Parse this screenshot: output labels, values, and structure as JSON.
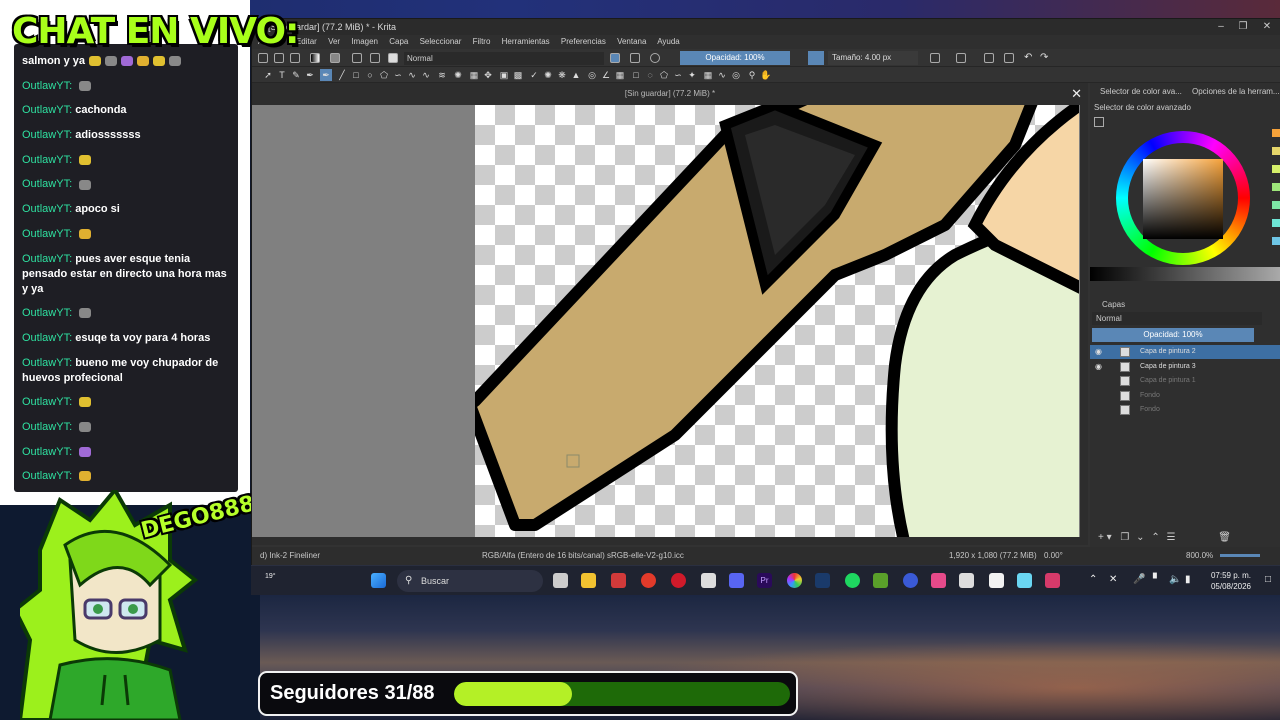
{
  "overlay": {
    "chat_title": "CHAT EN VIVO:",
    "avatar_tag": "DEGO888",
    "followers_label": "Seguidores 31/88",
    "followers_progress": 0.35
  },
  "chat": [
    {
      "user": "",
      "text": "salmon y ya",
      "emotes": 6
    },
    {
      "user": "OutlawYT:",
      "text": "",
      "emotes": 1
    },
    {
      "user": "OutlawYT:",
      "text": "cachonda",
      "emotes": 0
    },
    {
      "user": "OutlawYT:",
      "text": "adiosssssss",
      "emotes": 0
    },
    {
      "user": "OutlawYT:",
      "text": "",
      "emotes": 1
    },
    {
      "user": "OutlawYT:",
      "text": "",
      "emotes": 1
    },
    {
      "user": "OutlawYT:",
      "text": "apoco si",
      "emotes": 0
    },
    {
      "user": "OutlawYT:",
      "text": "",
      "emotes": 1
    },
    {
      "user": "OutlawYT:",
      "text": "pues aver esque tenia pensado estar en directo una hora mas y ya",
      "emotes": 0
    },
    {
      "user": "OutlawYT:",
      "text": "",
      "emotes": 1
    },
    {
      "user": "OutlawYT:",
      "text": "esuqe ta voy para 4 horas",
      "emotes": 0
    },
    {
      "user": "OutlawYT:",
      "text": "bueno me voy chupador de huevos profecional",
      "emotes": 0
    },
    {
      "user": "OutlawYT:",
      "text": "",
      "emotes": 1
    },
    {
      "user": "OutlawYT:",
      "text": "",
      "emotes": 1
    },
    {
      "user": "OutlawYT:",
      "text": "",
      "emotes": 1
    },
    {
      "user": "OutlawYT:",
      "text": "",
      "emotes": 1
    }
  ],
  "krita": {
    "window_title": "[Sin guardar]  (77.2 MiB) * - Krita",
    "doc_title": "[Sin guardar]  (77.2 MiB) *",
    "menu": [
      "Archivo",
      "Editar",
      "Ver",
      "Imagen",
      "Capa",
      "Seleccionar",
      "Filtro",
      "Herramientas",
      "Preferencias",
      "Ventana",
      "Ayuda"
    ],
    "blend_mode": "Normal",
    "opacity": "Opacidad: 100%",
    "size": "Tamaño: 4.00 px",
    "status_brush": "d) Ink-2 Fineliner",
    "status_color": "RGB/Alfa (Entero de 16 bits/canal)  sRGB-elle-V2-g10.icc",
    "status_dims": "1,920 x 1,080 (77.2 MiB)",
    "status_rotation": "0.00°",
    "status_zoom": "800.0%",
    "docker_tabs": [
      "Selector de color ava...",
      "Opciones de la herram..."
    ],
    "color_docker_title": "Selector de color avanzado",
    "layers_title": "Capas",
    "layers_blend": "Normal",
    "layers_opacity": "Opacidad: 100%",
    "layers": [
      {
        "name": "Capa de pintura 2",
        "selected": true,
        "visible": true
      },
      {
        "name": "Capa de pintura 3",
        "selected": false,
        "visible": true
      },
      {
        "name": "Capa de pintura 1",
        "selected": false,
        "visible": false
      },
      {
        "name": "Fondo",
        "selected": false,
        "visible": false
      },
      {
        "name": "Fondo",
        "selected": false,
        "visible": false
      }
    ]
  },
  "taskbar": {
    "search_placeholder": "Buscar",
    "time": "07:59 p. m.",
    "date": "05/08/2026",
    "weather": "19°"
  },
  "colors": {
    "accent_green": "#a8ff1a",
    "chat_user": "#2fe0a0",
    "krita_highlight": "#5a87b6",
    "progress_fill": "#b4f026",
    "progress_track": "#1e6a08"
  }
}
